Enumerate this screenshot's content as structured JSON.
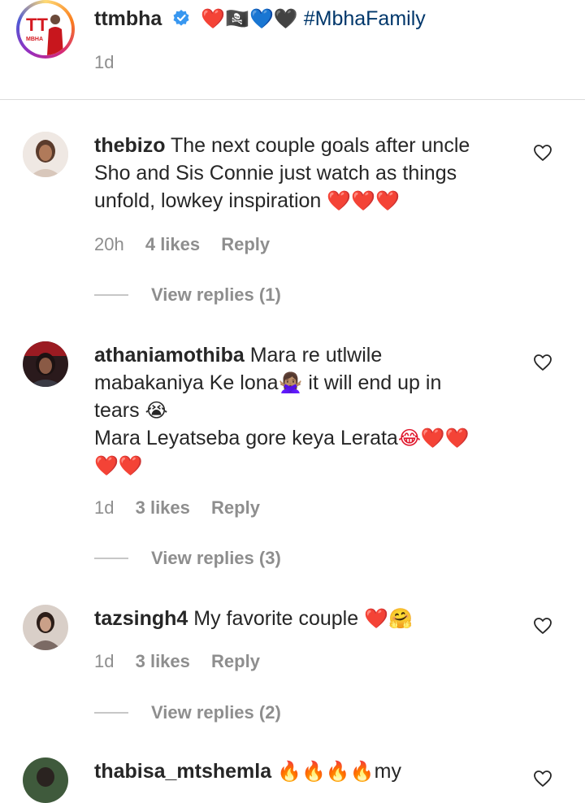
{
  "caption": {
    "username": "ttmbha",
    "emojis": "❤️🏴‍☠️💙🖤",
    "hashtag": "#MbhaFamily",
    "time": "1d",
    "avatar_text": "TT",
    "avatar_subtext": "MBHA"
  },
  "comments": [
    {
      "username": "thebizo",
      "lines": [
        "The next couple goals after uncle",
        "Sho and Sis Connie just watch as things",
        "unfold, lowkey inspiration"
      ],
      "trailing_emoji": "❤️❤️❤️",
      "time": "20h",
      "likes": "4 likes",
      "reply": "Reply",
      "view_replies": "View replies (1)"
    },
    {
      "username": "athaniamothiba",
      "lines": [
        "Mara re utlwile",
        "mabakaniya Ke lona",
        "it will end up in",
        "tears",
        "Mara Leyatseba gore keya Lerata"
      ],
      "emojis": [
        "🙅🏽‍♀️",
        "😭",
        "😂❤️❤️",
        "❤️❤️"
      ],
      "time": "1d",
      "likes": "3 likes",
      "reply": "Reply",
      "view_replies": "View replies (3)"
    },
    {
      "username": "tazsingh4",
      "lines": [
        "My favorite couple"
      ],
      "emojis": [
        "❤️🤗"
      ],
      "time": "1d",
      "likes": "3 likes",
      "reply": "Reply",
      "view_replies": "View replies (2)"
    },
    {
      "username": "thabisa_mtshemla",
      "lines": [
        "my"
      ],
      "emojis": [
        "🔥🔥🔥🔥"
      ]
    }
  ],
  "colors": {
    "verified": "#3897f0",
    "hashtag": "#00376b",
    "heart": "#e0182d",
    "meta": "#8e8e8e"
  },
  "icons": {
    "verified": "verified-badge-icon",
    "like": "heart-outline-icon"
  }
}
